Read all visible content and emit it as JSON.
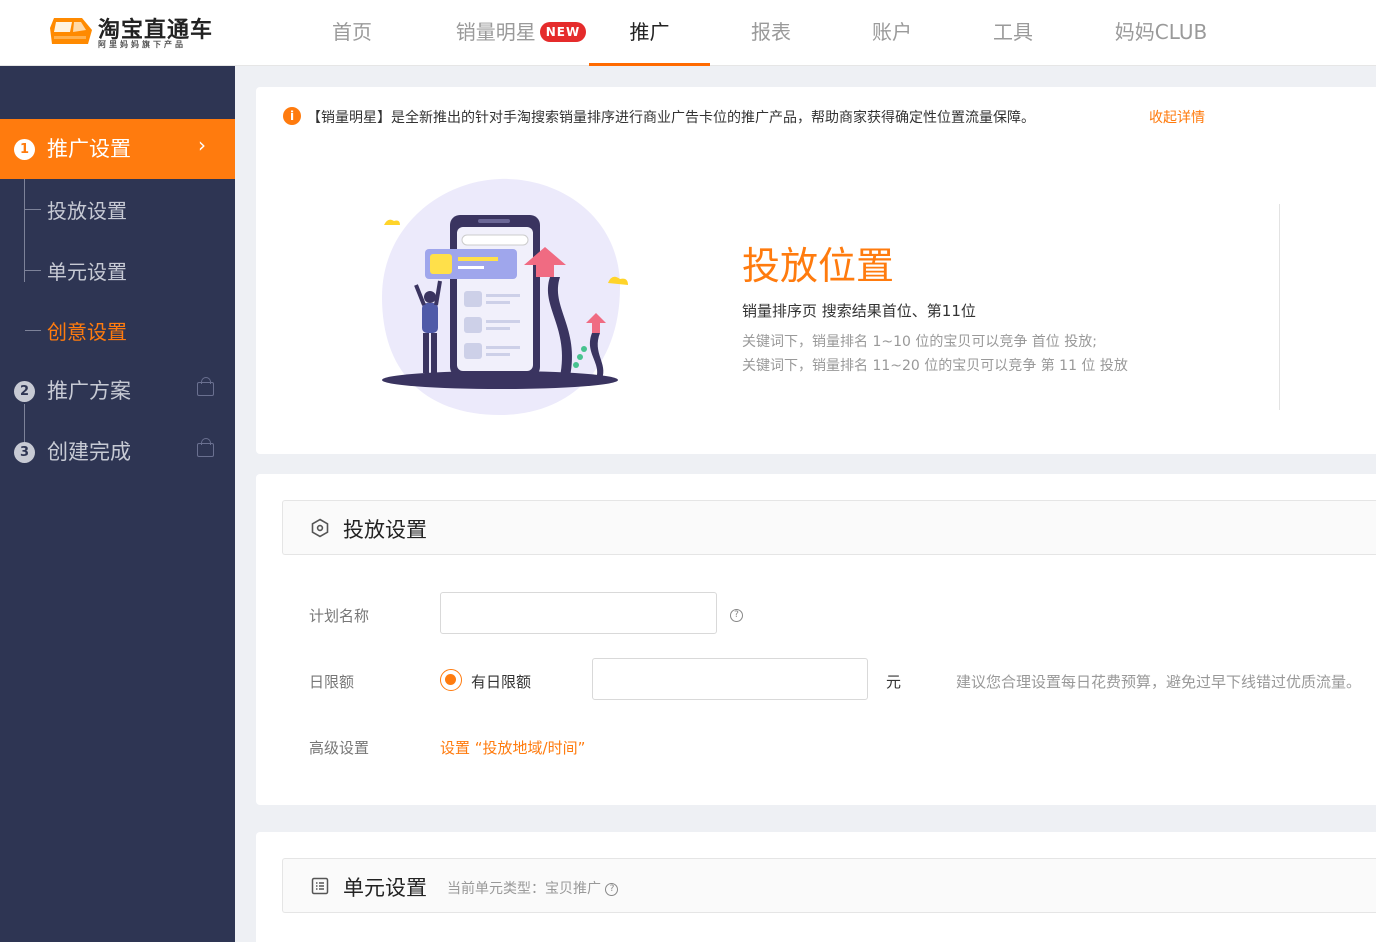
{
  "brand": {
    "title": "淘宝直通车",
    "subtitle": "阿里妈妈旗下产品"
  },
  "nav": {
    "items": [
      {
        "label": "首页"
      },
      {
        "label": "销量明星",
        "badge": "NEW"
      },
      {
        "label": "推广"
      },
      {
        "label": "报表"
      },
      {
        "label": "账户"
      },
      {
        "label": "工具"
      },
      {
        "label": "妈妈CLUB"
      }
    ],
    "active": "推广"
  },
  "sidebar": {
    "steps": [
      {
        "num": "1",
        "label": "推广设置",
        "active": true,
        "children": [
          {
            "label": "投放设置"
          },
          {
            "label": "单元设置"
          },
          {
            "label": "创意设置",
            "current": true
          }
        ]
      },
      {
        "num": "2",
        "label": "推广方案",
        "locked": true
      },
      {
        "num": "3",
        "label": "创建完成",
        "locked": true
      }
    ],
    "chevron": "›"
  },
  "notice": {
    "icon": "info-icon",
    "text": "【销量明星】是全新推出的针对手淘搜索销量排序进行商业广告卡位的推广产品，帮助商家获得确定性位置流量保障。",
    "link": "收起详情"
  },
  "placement": {
    "title": "投放位置",
    "subtitle": "销量排序页 搜索结果首位、第11位",
    "desc": [
      "关键词下，销量排名 1~10 位的宝贝可以竞争 首位 投放;",
      "关键词下，销量排名 11~20 位的宝贝可以竞争 第 11 位 投放"
    ]
  },
  "delivery": {
    "title": "投放设置",
    "plan_name_label": "计划名称",
    "plan_name_value": "",
    "help_glyph": "?",
    "budget_label": "日限额",
    "budget_option": "有日限额",
    "budget_value": "",
    "budget_unit": "元",
    "budget_tip": "建议您合理设置每日花费预算，避免过早下线错过优质流量。",
    "advanced_label": "高级设置",
    "advanced_link": "设置 “投放地域/时间”"
  },
  "unit": {
    "title": "单元设置",
    "note": "当前单元类型：宝贝推广"
  },
  "colors": {
    "accent": "#ff7b0e",
    "sidebar": "#2e3553",
    "badge": "#e52b2b"
  }
}
